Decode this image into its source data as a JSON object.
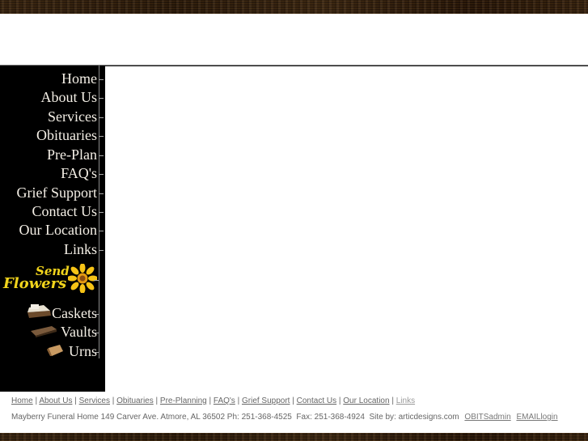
{
  "sidebar": {
    "nav_items": [
      {
        "label": "Home"
      },
      {
        "label": "About Us"
      },
      {
        "label": "Services"
      },
      {
        "label": "Obituaries"
      },
      {
        "label": "Pre-Plan"
      },
      {
        "label": "FAQ's"
      },
      {
        "label": "Grief Support"
      },
      {
        "label": "Contact Us"
      },
      {
        "label": "Our Location"
      },
      {
        "label": "Links"
      }
    ],
    "send_flowers": {
      "line1": "Send",
      "line2": "Flowers",
      "icon": "sunflower-icon"
    },
    "products": [
      {
        "label": "Caskets",
        "icon": "casket-icon"
      },
      {
        "label": "Vaults",
        "icon": "vault-icon"
      },
      {
        "label": "Urns",
        "icon": "urn-icon"
      }
    ]
  },
  "footer": {
    "links": [
      {
        "label": "Home"
      },
      {
        "label": "About Us"
      },
      {
        "label": "Services"
      },
      {
        "label": "Obituaries"
      },
      {
        "label": "Pre-Planning"
      },
      {
        "label": "FAQ's"
      },
      {
        "label": "Grief Support"
      },
      {
        "label": "Contact Us"
      },
      {
        "label": "Our Location"
      },
      {
        "label": "Links"
      }
    ],
    "separator": "|",
    "info_text": "Mayberry Funeral Home 149 Carver Ave. Atmore, AL 36502 Ph: 251-368-4525  Fax: 251-368-4924  Site by: articdesigns.com",
    "admin_link": "OBITSadmin",
    "email_link": "EMAILlogin"
  },
  "colors": {
    "wood": "#3a2410",
    "sidebar_bg": "#000000",
    "flowers_text": "#f1d41c",
    "footer_text": "#666666"
  }
}
